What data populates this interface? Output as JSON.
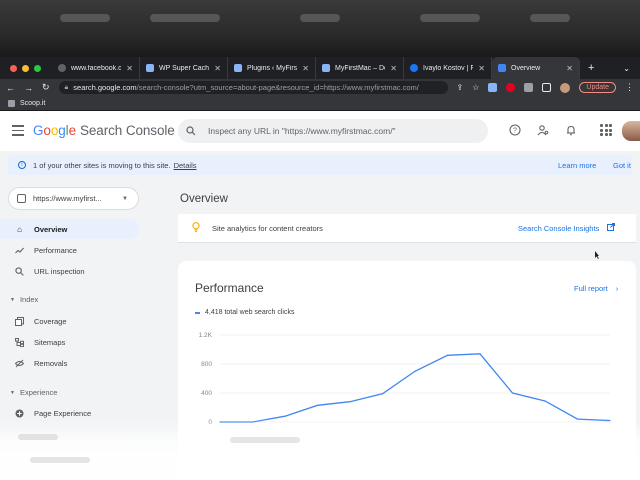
{
  "browser": {
    "tabs": [
      {
        "label": "www.facebook.com",
        "favicon_color": "#5f6368"
      },
      {
        "label": "WP Super Cache",
        "favicon_color": "#8ab4f8"
      },
      {
        "label": "Plugins ‹ MyFirstM",
        "favicon_color": "#8ab4f8"
      },
      {
        "label": "MyFirstMac – Dow",
        "favicon_color": "#8ab4f8"
      },
      {
        "label": "Ivaylo Kostov | Fac",
        "favicon_color": "#1877f2"
      },
      {
        "label": "Overview",
        "favicon_color": "#4285f4",
        "active": true
      }
    ],
    "url_host": "search.google.com",
    "url_path": "/search-console?utm_source=about-page&resource_id=https://www.myfirstmac.com/",
    "update_label": "Update",
    "bookmark": "Scoop.it"
  },
  "app": {
    "brand_google": [
      "G",
      "o",
      "o",
      "g",
      "l",
      "e"
    ],
    "brand_product": "Search Console",
    "search_placeholder": "Inspect any URL in \"https://www.myfirstmac.com/\"",
    "banner": {
      "text": "1 of your other sites is moving to this site.",
      "details": "Details",
      "learn_more": "Learn more",
      "got_it": "Got it"
    },
    "property": "https://www.myfirst...",
    "nav": {
      "overview": "Overview",
      "performance": "Performance",
      "url_inspection": "URL inspection",
      "index_section": "Index",
      "coverage": "Coverage",
      "sitemaps": "Sitemaps",
      "removals": "Removals",
      "experience_section": "Experience",
      "page_experience": "Page Experience"
    },
    "main": {
      "title": "Overview",
      "insights_text": "Site analytics for content creators",
      "insights_link": "Search Console Insights",
      "performance_title": "Performance",
      "full_report": "Full report",
      "legend_label": "4,418 total web search clicks"
    }
  },
  "colors": {
    "accent": "#1a73e8",
    "series": "#4285f4"
  },
  "chart_data": {
    "type": "line",
    "y_ticks": [
      "1.2K",
      "800",
      "400",
      "0"
    ],
    "ylim": [
      0,
      1200
    ],
    "series": [
      {
        "name": "4,418 total web search clicks",
        "values": [
          0,
          0,
          80,
          230,
          280,
          390,
          700,
          920,
          940,
          400,
          290,
          40,
          20
        ]
      }
    ]
  }
}
